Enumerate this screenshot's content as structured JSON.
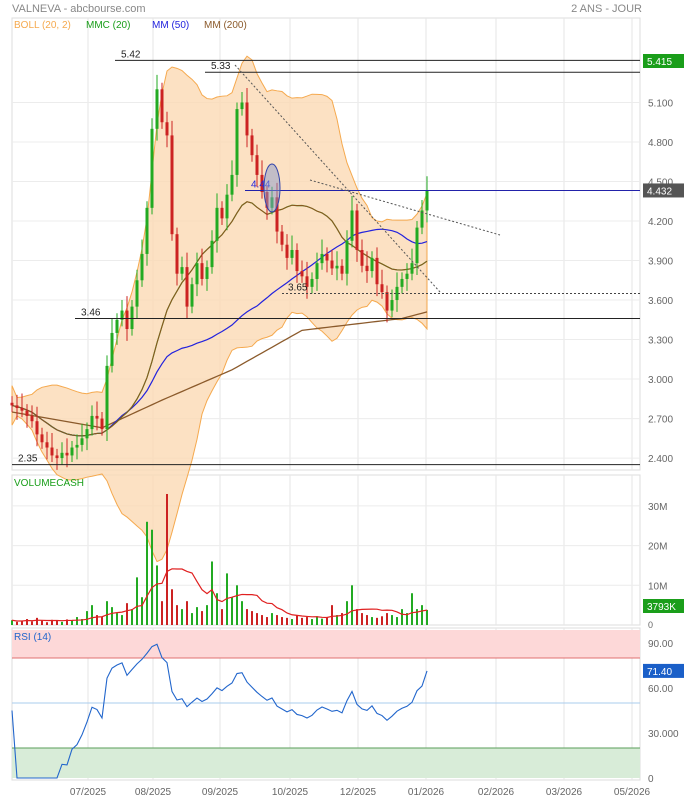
{
  "header": {
    "title": "VALNEVA - abcbourse.com",
    "period": "2 ANS - JOUR"
  },
  "legend": [
    {
      "label": "BOLL (20, 2)",
      "color": "#f5a94e"
    },
    {
      "label": "MMC (20)",
      "color": "#1a9e1a"
    },
    {
      "label": "MM (50)",
      "color": "#2222dd"
    },
    {
      "label": "MM (200)",
      "color": "#8b5a2b"
    }
  ],
  "chart_data": {
    "type": "candlestick",
    "title": "VALNEVA",
    "x_tick_labels": [
      "07/2025",
      "08/2025",
      "09/2025",
      "10/2025",
      "12/2025",
      "01/2026",
      "02/2026",
      "03/2026",
      "05/2026"
    ],
    "price_ticks": [
      "5.100",
      "4.800",
      "4.500",
      "4.200",
      "3.900",
      "3.600",
      "3.300",
      "3.000",
      "2.700",
      "2.400"
    ],
    "price_tick_values": [
      5.1,
      4.8,
      4.5,
      4.2,
      3.9,
      3.6,
      3.3,
      3.0,
      2.7,
      2.4
    ],
    "closes": [
      2.8,
      2.78,
      2.76,
      2.72,
      2.68,
      2.58,
      2.52,
      2.48,
      2.42,
      2.4,
      2.44,
      2.42,
      2.48,
      2.5,
      2.55,
      2.62,
      2.72,
      2.7,
      2.62,
      3.1,
      3.35,
      3.45,
      3.52,
      3.38,
      3.55,
      3.75,
      3.95,
      4.3,
      4.9,
      5.2,
      4.95,
      4.85,
      4.1,
      3.8,
      3.85,
      3.55,
      3.72,
      3.88,
      3.76,
      3.85,
      4.05,
      4.3,
      4.22,
      4.4,
      4.55,
      5.05,
      5.1,
      4.85,
      4.7,
      4.55,
      4.42,
      4.3,
      4.38,
      4.12,
      4.02,
      3.92,
      3.98,
      3.82,
      3.78,
      3.7,
      3.76,
      3.88,
      3.95,
      3.9,
      3.84,
      3.86,
      3.8,
      4.05,
      4.28,
      3.98,
      3.86,
      3.82,
      3.92,
      3.72,
      3.66,
      3.52,
      3.6,
      3.7,
      3.76,
      3.8,
      3.88,
      4.15,
      4.28,
      4.43
    ],
    "mm200_keypoints": [
      [
        0,
        2.75
      ],
      [
        18,
        2.63
      ],
      [
        30,
        2.84
      ],
      [
        44,
        3.07
      ],
      [
        58,
        3.37
      ],
      [
        78,
        3.46
      ],
      [
        83,
        3.51
      ]
    ],
    "volumes_m": [
      1.2,
      0.8,
      1.0,
      1.5,
      0.9,
      1.8,
      1.1,
      0.7,
      1.3,
      1.0,
      0.8,
      1.4,
      1.1,
      2.0,
      1.5,
      3.5,
      5.0,
      2.5,
      2.0,
      6.0,
      4.5,
      3.0,
      2.5,
      5.5,
      4.0,
      12.0,
      7.0,
      26.0,
      24.0,
      15.0,
      6.0,
      33.0,
      9.0,
      5.0,
      4.0,
      6.0,
      3.0,
      4.5,
      3.5,
      5.0,
      16.0,
      8.0,
      4.0,
      13.0,
      7.0,
      10.0,
      6.0,
      4.0,
      3.5,
      3.0,
      2.5,
      2.0,
      3.0,
      2.5,
      2.0,
      1.8,
      1.5,
      2.5,
      1.8,
      2.0,
      1.5,
      2.2,
      1.6,
      2.0,
      5.0,
      2.5,
      3.0,
      6.0,
      10.0,
      4.0,
      3.0,
      2.5,
      2.0,
      1.8,
      2.2,
      3.0,
      2.5,
      2.0,
      4.0,
      3.0,
      8.0,
      4.0,
      5.0,
      3.8
    ],
    "volume_ticks": [
      "30M",
      "20M",
      "10M",
      "0"
    ],
    "rsi_ticks": [
      "90.00",
      "60.00",
      "30.000",
      "0"
    ],
    "annotations": [
      {
        "label": "5.42",
        "value": 5.42
      },
      {
        "label": "5.33",
        "value": 5.33
      },
      {
        "label": "4.44",
        "value": 4.432
      },
      {
        "label": "3.65",
        "value": 3.65
      },
      {
        "label": "3.46",
        "value": 3.46
      },
      {
        "label": "2.35",
        "value": 2.35
      }
    ]
  },
  "badges": {
    "price_high": "5.415",
    "price_last": "4.432",
    "volume_last": "3793K",
    "rsi_last": "71.40"
  },
  "panels": {
    "volume_title": "VOLUMECASH",
    "rsi_title": "RSI (14)"
  },
  "colors": {
    "up": "#22aa22",
    "down": "#cc2222",
    "boll_fill": "#fbd9b4",
    "rsi": "#2266cc",
    "vol_avg": "#e02020"
  }
}
